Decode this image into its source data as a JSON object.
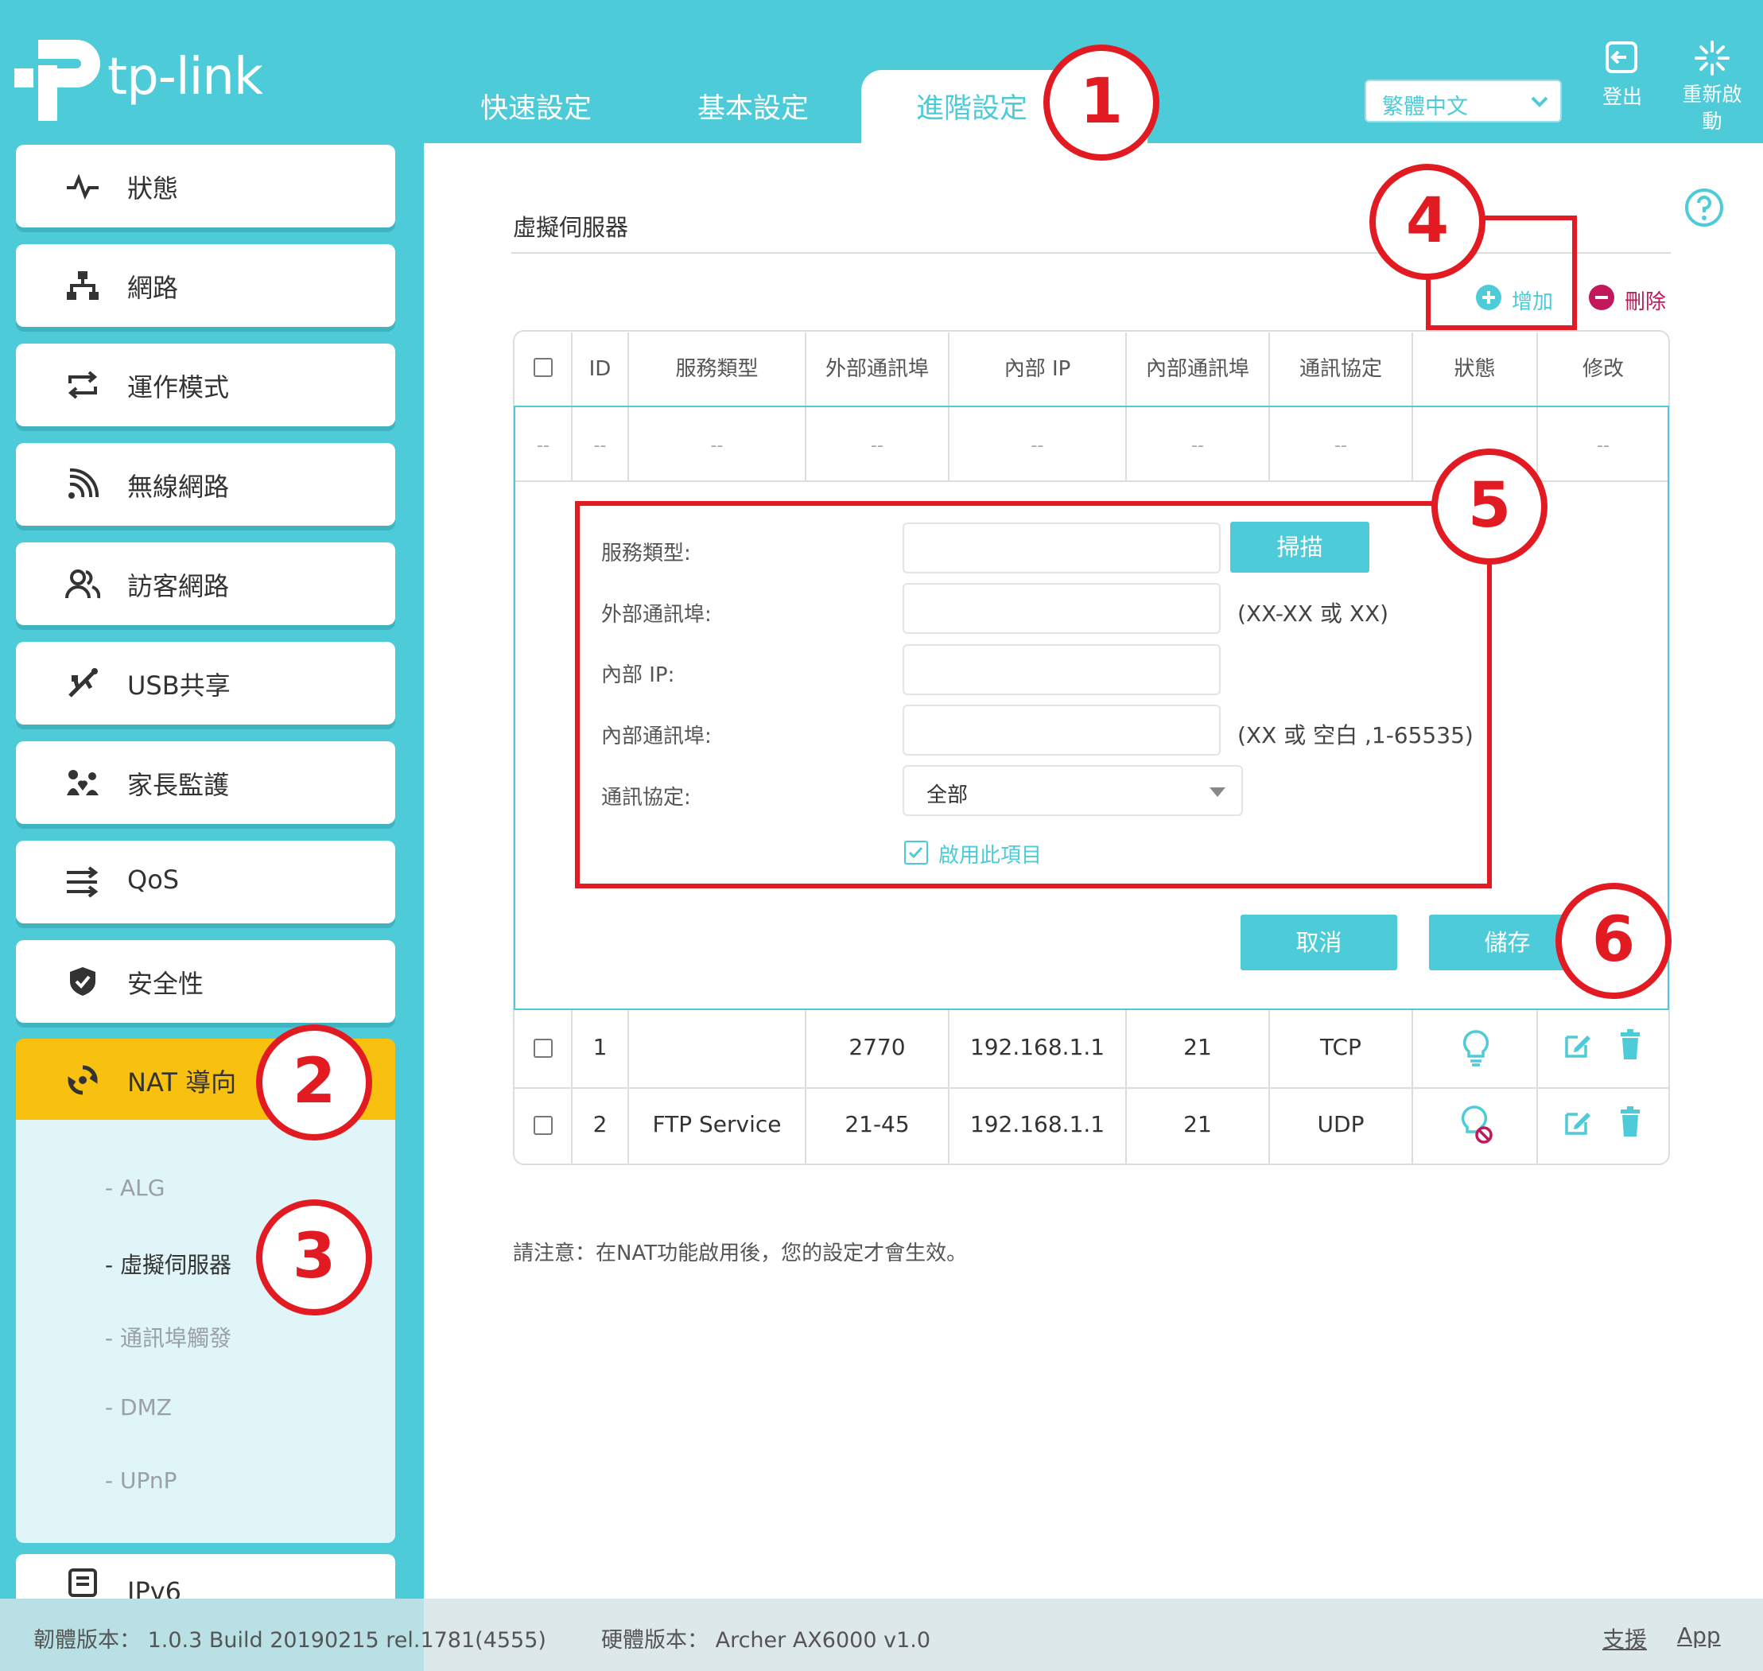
{
  "brand": {
    "logo_text": "tp-link",
    "accent": "#4ecbd8",
    "highlight": "#f9c10f",
    "callout_color": "#e21b22"
  },
  "header": {
    "tabs": [
      {
        "label": "快速設定"
      },
      {
        "label": "基本設定"
      },
      {
        "label": "進階設定",
        "active": true
      }
    ],
    "language": "繁體中文",
    "logout_label": "登出",
    "reboot_label": "重新啟動"
  },
  "sidebar": {
    "items": [
      {
        "label": "狀態",
        "icon": "pulse-icon"
      },
      {
        "label": "網路",
        "icon": "network-icon"
      },
      {
        "label": "運作模式",
        "icon": "mode-switch-icon"
      },
      {
        "label": "無線網路",
        "icon": "wireless-icon"
      },
      {
        "label": "訪客網路",
        "icon": "guest-icon"
      },
      {
        "label": "USB共享",
        "icon": "usb-icon"
      },
      {
        "label": "家長監護",
        "icon": "parental-icon"
      },
      {
        "label": "QoS",
        "icon": "qos-icon"
      },
      {
        "label": "安全性",
        "icon": "shield-icon"
      },
      {
        "label": "NAT 導向",
        "icon": "nat-icon",
        "active": true
      },
      {
        "label": "IPv6",
        "icon": "ipv6-icon"
      }
    ],
    "nat_sub_items": [
      {
        "label": "ALG"
      },
      {
        "label": "虛擬伺服器",
        "current": true
      },
      {
        "label": "通訊埠觸發"
      },
      {
        "label": "DMZ"
      },
      {
        "label": "UPnP"
      }
    ]
  },
  "main": {
    "title": "虛擬伺服器",
    "add_label": "增加",
    "delete_label": "刪除",
    "table": {
      "columns": [
        "ID",
        "服務類型",
        "外部通訊埠",
        "內部 IP",
        "內部通訊埠",
        "通訊協定",
        "狀態",
        "修改"
      ],
      "placeholder": "--",
      "rows": [
        {
          "id": "1",
          "service": "",
          "ext_port": "2770",
          "ip": "192.168.1.1",
          "int_port": "21",
          "protocol": "TCP",
          "status": "enabled"
        },
        {
          "id": "2",
          "service": "FTP Service",
          "ext_port": "21-45",
          "ip": "192.168.1.1",
          "int_port": "21",
          "protocol": "UDP",
          "status": "disabled"
        }
      ]
    },
    "form": {
      "service_type_label": "服務類型:",
      "scan_button": "掃描",
      "ext_port_label": "外部通訊埠:",
      "ext_port_hint": "(XX-XX 或 XX)",
      "int_ip_label": "內部 IP:",
      "int_port_label": "內部通訊埠:",
      "int_port_hint": "(XX 或 空白 ,1-65535)",
      "protocol_label": "通訊協定:",
      "protocol_value": "全部",
      "enable_label": "啟用此項目",
      "enable_checked": true,
      "cancel_button": "取消",
      "save_button": "儲存"
    },
    "note": "請注意：在NAT功能啟用後，您的設定才會生效。"
  },
  "callouts": [
    "1",
    "2",
    "3",
    "4",
    "5",
    "6"
  ],
  "footer": {
    "firmware_label": "韌體版本：",
    "firmware_value": "1.0.3 Build 20190215 rel.1781(4555)",
    "hardware_label": "硬體版本：",
    "hardware_value": "Archer AX6000 v1.0",
    "support_link": "支援",
    "app_link": "App"
  }
}
